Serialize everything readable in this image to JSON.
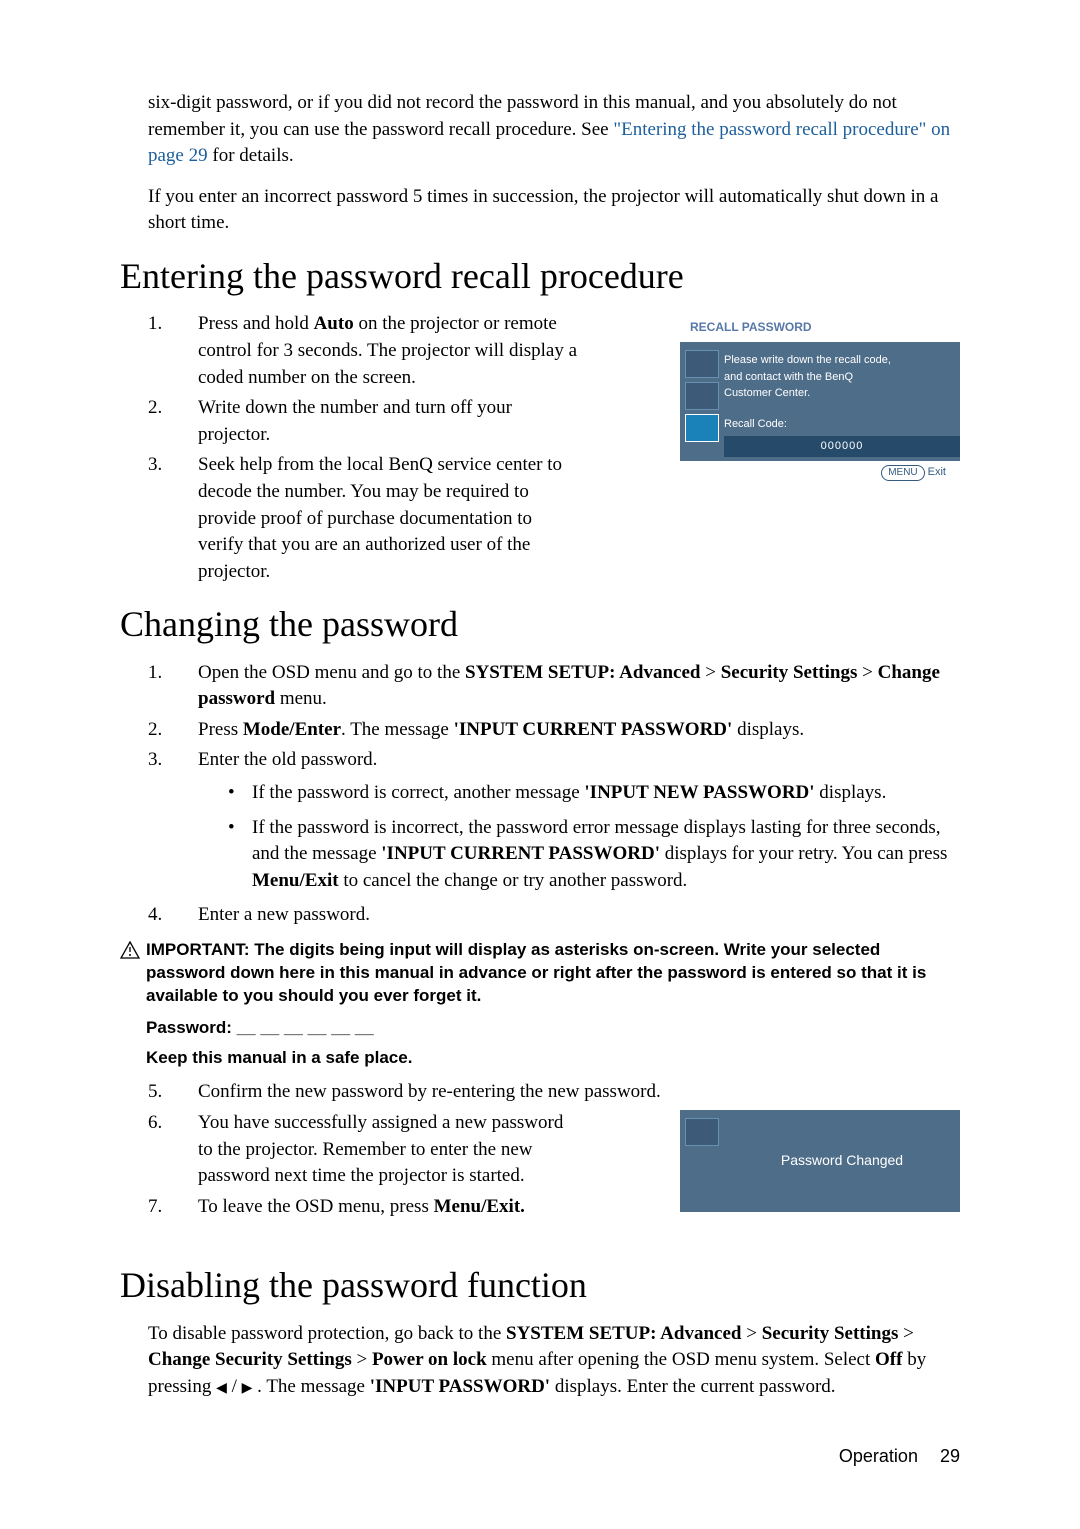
{
  "intro": {
    "para1a": "six-digit password, or if you did not record the password in this manual, and you absolutely do not remember it, you can use the password recall procedure. See ",
    "para1link": "\"Entering the password recall procedure\" on page 29",
    "para1b": " for details.",
    "para2": "If you enter an incorrect password 5 times in succession, the projector will automatically shut down in a short time."
  },
  "recall": {
    "heading": "Entering the password recall procedure",
    "items": [
      {
        "n": "1.",
        "t": "Press and hold ",
        "b": "Auto",
        "t2": " on the projector or remote control for 3 seconds. The projector will display a coded number on the screen."
      },
      {
        "n": "2.",
        "t": "Write down the number and turn off your projector."
      },
      {
        "n": "3.",
        "t": "Seek help from the local BenQ service center to decode the number. You may be required to provide proof of purchase documentation to verify that you are an authorized user of the projector."
      }
    ],
    "panel": {
      "title": "RECALL PASSWORD",
      "line1": "Please write down the recall code,",
      "line2": "and contact with the BenQ",
      "line3": "Customer Center.",
      "code_label": "Recall Code:",
      "code_value": "000000",
      "menu": "MENU",
      "exit": "Exit"
    }
  },
  "change": {
    "heading": "Changing the password",
    "s1a": "Open the OSD menu and go to the ",
    "s1b": "SYSTEM SETUP: Advanced",
    "s1c": " > ",
    "s1d": "Security Settings",
    "s1e": " > ",
    "s1f": "Change password",
    "s1g": " menu.",
    "s2a": "Press ",
    "s2b": "Mode/Enter",
    "s2c": ". The message ",
    "s2d": "'INPUT CURRENT PASSWORD'",
    "s2e": " displays.",
    "s3": "Enter the old password.",
    "b1a": "If the password is correct, another message ",
    "b1b": "'INPUT NEW PASSWORD'",
    "b1c": " displays.",
    "b2a": "If the password is incorrect, the password error message displays lasting for three seconds, and the message ",
    "b2b": "'INPUT CURRENT PASSWORD'",
    "b2c": " displays for your retry. You can press ",
    "b2d": "Menu/Exit",
    "b2e": " to cancel the change or try another password.",
    "s4": "Enter a new password.",
    "important": "IMPORTANT: The digits being input will display as asterisks on-screen. Write your selected password down here in this manual in advance or right after the password is entered so that it is available to you should you ever forget it.",
    "password_line": "Password: __ __ __ __ __ __",
    "keep_line": "Keep this manual in a safe place.",
    "s5": "Confirm the new password by re-entering the new password.",
    "s6": "You have successfully assigned a new password to the projector. Remember to enter the new password next time the projector is started.",
    "s7a": "To leave the OSD menu, press ",
    "s7b": "Menu/Exit.",
    "panel_changed": "Password Changed"
  },
  "disable": {
    "heading": "Disabling the password function",
    "p1": "To disable password protection, go back to the ",
    "p2": "SYSTEM SETUP: Advanced",
    "p3": " > ",
    "p4": "Security Settings",
    "p5": " > ",
    "p6": "Change Security Settings",
    "p7": " > ",
    "p8": "Power on lock",
    "p9": " menu after opening the OSD menu system. Select ",
    "p10": "Off",
    "p11": " by pressing ",
    "tri_l": "◀",
    "slash": " / ",
    "tri_r": "▶",
    "p12": " . The message ",
    "p13": "'INPUT PASSWORD'",
    "p14": " displays. Enter the current password."
  },
  "footer": {
    "section": "Operation",
    "page": "29"
  }
}
